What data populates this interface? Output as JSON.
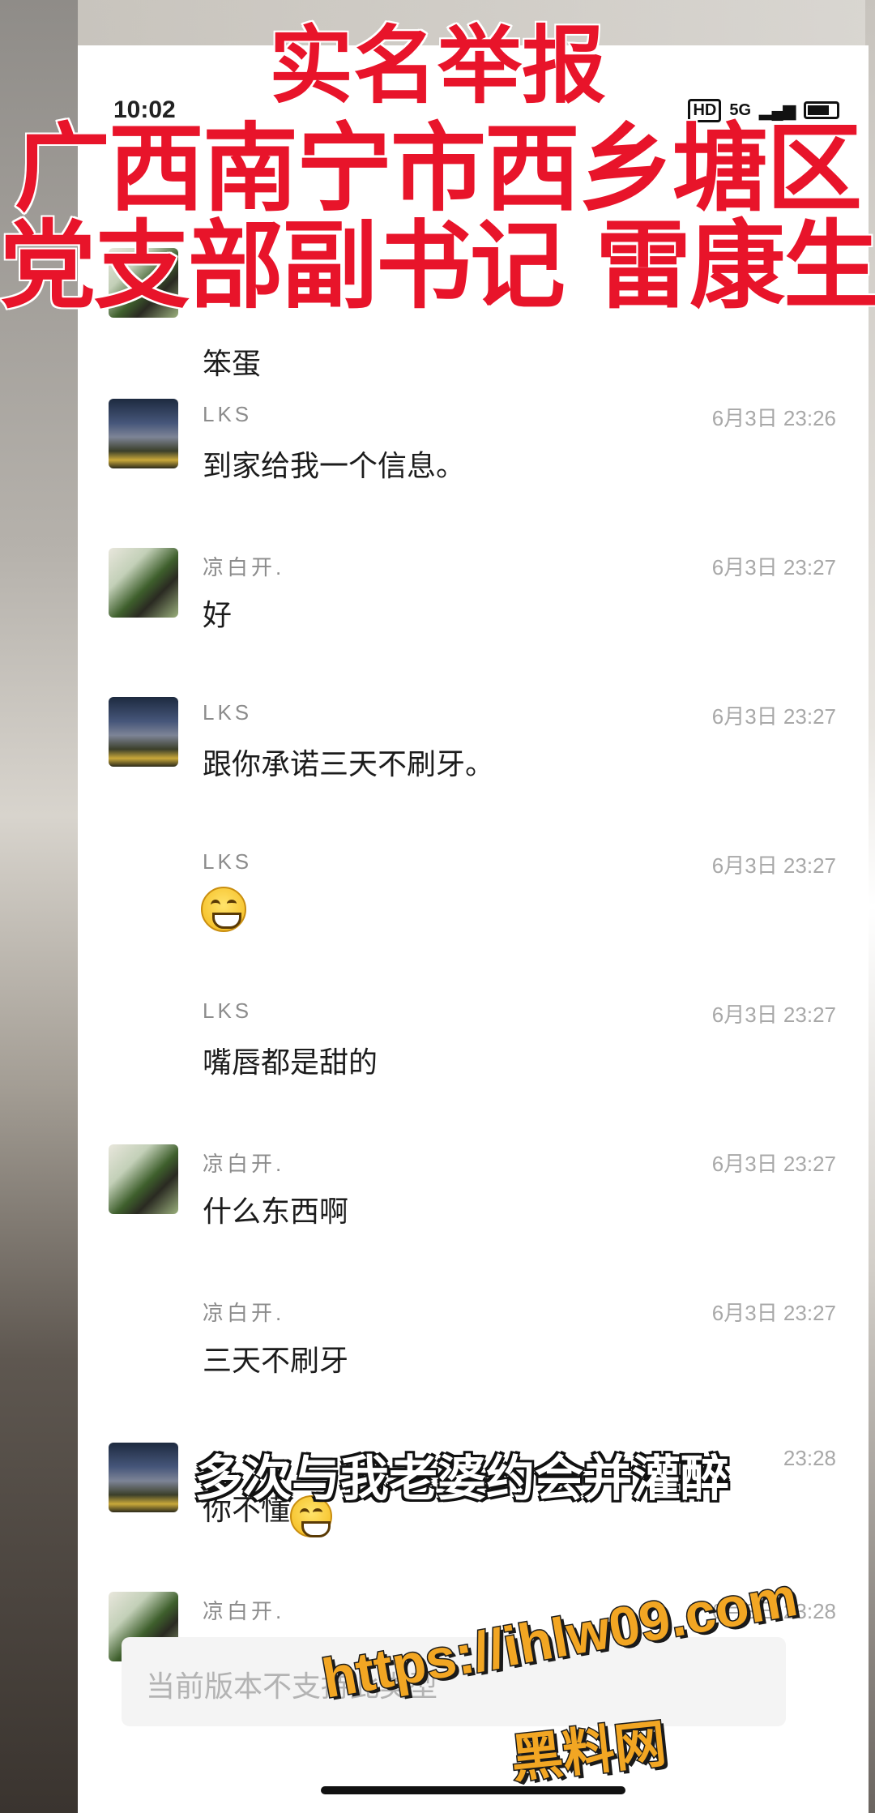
{
  "overlay": {
    "title_line1": "实名举报",
    "title_line2": "广西南宁市西乡塘区",
    "title_line3": "党支部副书记 雷康生",
    "caption": "多次与我老婆约会并灌醉"
  },
  "status_bar": {
    "time": "10:02",
    "network_label": "5G",
    "hd_label": "HD"
  },
  "messages": [
    {
      "sender": "",
      "time": "",
      "text": "笨蛋",
      "avatar": "lbk"
    },
    {
      "sender": "LKS",
      "time": "6月3日 23:26",
      "text": "到家给我一个信息。",
      "avatar": "lks"
    },
    {
      "sender": "凉白开.",
      "time": "6月3日 23:27",
      "text": "好",
      "avatar": "lbk"
    },
    {
      "sender": "LKS",
      "time": "6月3日 23:27",
      "text": "跟你承诺三天不刷牙。",
      "avatar": "lks"
    },
    {
      "sender": "LKS",
      "time": "6月3日 23:27",
      "text": "",
      "emoji": "grin-emoji",
      "avatar": ""
    },
    {
      "sender": "LKS",
      "time": "6月3日 23:27",
      "text": "嘴唇都是甜的",
      "avatar": ""
    },
    {
      "sender": "凉白开.",
      "time": "6月3日 23:27",
      "text": "什么东西啊",
      "avatar": "lbk"
    },
    {
      "sender": "凉白开.",
      "time": "6月3日 23:27",
      "text": "三天不刷牙",
      "avatar": ""
    },
    {
      "sender": "",
      "time": "23:28",
      "text": "你不懂",
      "avatar": "lks"
    },
    {
      "sender": "凉白开.",
      "time": "6月3日 23:28",
      "text": "",
      "avatar": "lbk"
    }
  ],
  "input_bar": {
    "text": "当前版本不支持此类型"
  },
  "watermark": {
    "url": "https://ihlw09.com",
    "name": "黑料网"
  },
  "colors": {
    "title_red": "#e8142a",
    "watermark_orange": "#f2a623"
  }
}
